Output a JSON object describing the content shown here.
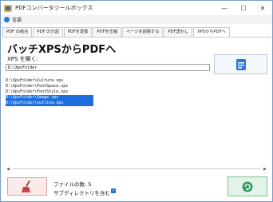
{
  "window": {
    "title": "PDFコンバータツールボックス"
  },
  "window_controls": {
    "minimize": "—",
    "maximize": "☐",
    "close": "✕"
  },
  "menu": {
    "language": "言語"
  },
  "tabs": [
    {
      "label": "PDF の結合"
    },
    {
      "label": "PDF の分割"
    },
    {
      "label": "PDFを変換"
    },
    {
      "label": "PDFを圧縮"
    },
    {
      "label": "ページを削除する"
    },
    {
      "label": "PDF透かし"
    },
    {
      "label": "XPSからPDFへ"
    }
  ],
  "active_tab": 6,
  "main": {
    "heading": "バッチXPSからPDFへ",
    "open_label": "XPS を開く:",
    "path_value": "D:\\XpsFolder"
  },
  "file_list": [
    {
      "path": "D:\\XpsFolder\\Culture.xps",
      "selected": false
    },
    {
      "path": "D:\\XpsFolder\\FontSpace.xps",
      "selected": false
    },
    {
      "path": "D:\\XpsFolder\\FontStyle.xps",
      "selected": false
    },
    {
      "path": "D:\\XpsFolder\\Image.xps",
      "selected": true
    },
    {
      "path": "D:\\XpsFolder\\outline.xps",
      "selected": true
    }
  ],
  "footer": {
    "file_count": "ファイルの数: 5",
    "subdirectories_label": "サブディレクトリを含む",
    "subdirectories_checked": true
  },
  "icons": {
    "app": "pdf-toolbox-icon",
    "language": "globe-icon",
    "open_file": "file-icon",
    "clear": "broom-icon",
    "convert": "refresh-icon"
  },
  "colors": {
    "selection": "#1e6fdc",
    "clear_button": "#fbeaea",
    "convert_button": "#e3f3e9"
  }
}
